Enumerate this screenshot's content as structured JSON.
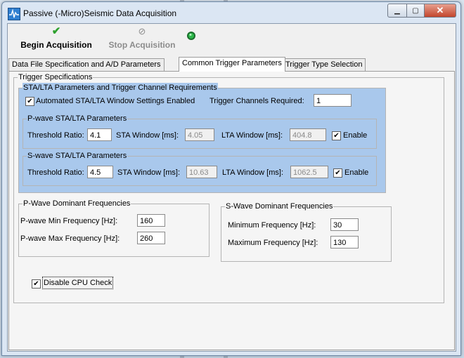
{
  "window": {
    "title": "Passive (-Micro)Seismic Data Acquisition"
  },
  "toolbar": {
    "begin_label": "Begin Acquisition",
    "stop_label": "Stop Acquisition",
    "begin_icon": "checkmark-icon",
    "stop_icon": "stop-icon",
    "status_icon": "led-icon"
  },
  "tabs": [
    {
      "label": "Data File Specification and A/D Parameters",
      "active": false
    },
    {
      "label": "Common Trigger Parameters",
      "active": true
    },
    {
      "label": "Trigger Type Selection",
      "active": false
    }
  ],
  "trigger_spec": {
    "legend": "Trigger Specifications",
    "sta_lta": {
      "legend": "STA/LTA Parameters and Trigger Channel Requirements",
      "auto_label": "Automated STA/LTA Window Settings Enabled",
      "auto_checked": true,
      "channels_label": "Trigger Channels Required:",
      "channels_value": "1"
    },
    "pwave": {
      "legend": "P-wave STA/LTA Parameters",
      "threshold_label": "Threshold Ratio:",
      "threshold_value": "4.1",
      "sta_label": "STA Window [ms]:",
      "sta_value": "4.05",
      "lta_label": "LTA Window [ms]:",
      "lta_value": "404.8",
      "enable_label": "Enable",
      "enable_checked": true
    },
    "swave": {
      "legend": "S-wave STA/LTA Parameters",
      "threshold_label": "Threshold Ratio:",
      "threshold_value": "4.5",
      "sta_label": "STA Window [ms]:",
      "sta_value": "10.63",
      "lta_label": "LTA Window [ms]:",
      "lta_value": "1062.5",
      "enable_label": "Enable",
      "enable_checked": true
    },
    "p_dom": {
      "legend": "P-Wave Dominant Frequencies",
      "min_label": "P-wave Min Frequency [Hz]:",
      "min_value": "160",
      "max_label": "P-wave Max Frequency [Hz]:",
      "max_value": "260"
    },
    "s_dom": {
      "legend": "S-Wave Dominant Frequencies",
      "min_label": "Minimum Frequency [Hz]:",
      "min_value": "30",
      "max_label": "Maximum Frequency [Hz]:",
      "max_value": "130"
    },
    "cpu": {
      "label": "Disable CPU Check",
      "checked": true
    }
  },
  "colors": {
    "group_blue": "#a9c8ec",
    "led_green": "#2db84a",
    "check_green": "#2ea12e"
  }
}
